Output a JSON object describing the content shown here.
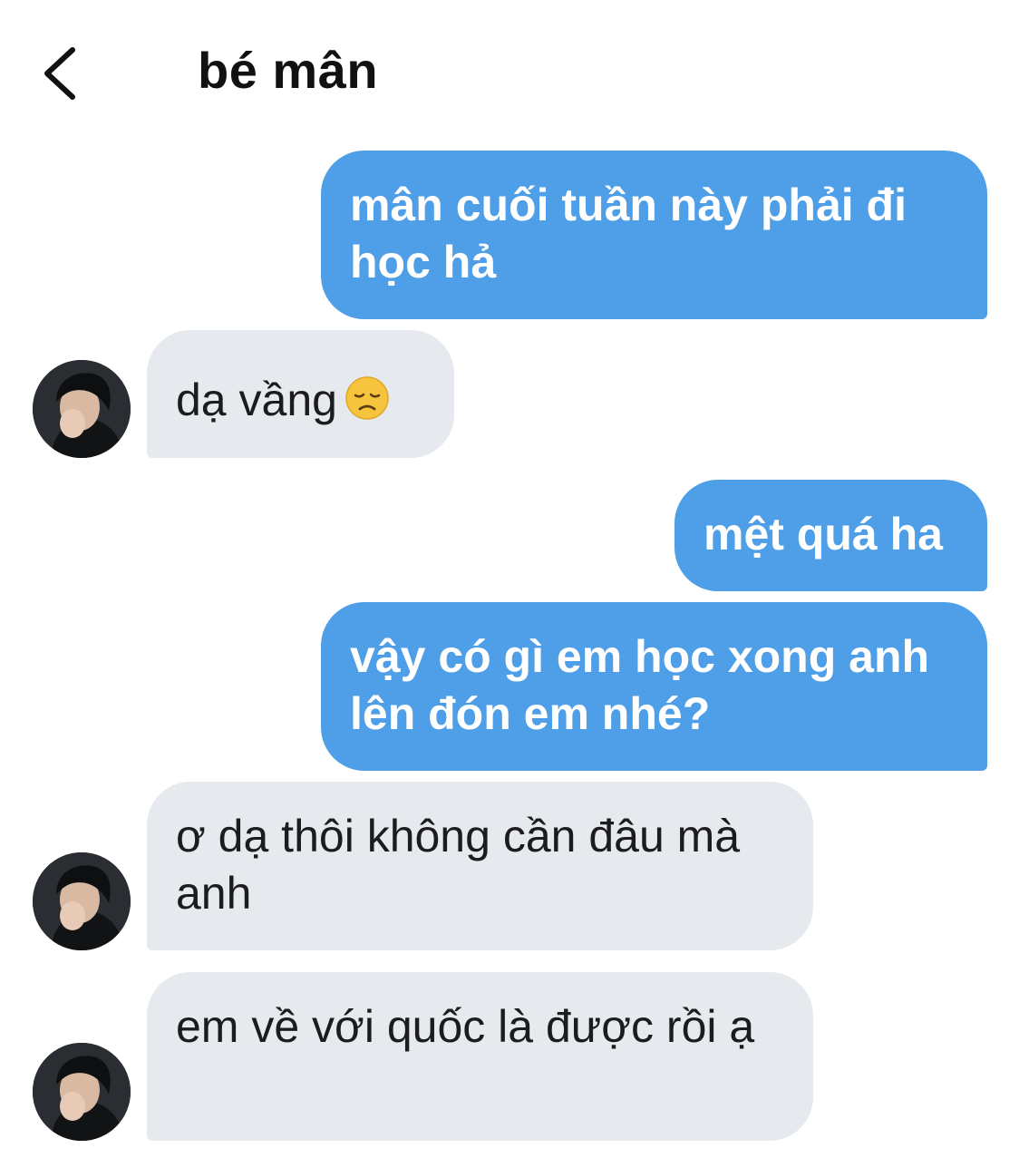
{
  "header": {
    "back_icon": "chevron-left-icon",
    "title": "bé mân"
  },
  "messages": [
    {
      "direction": "outgoing",
      "text": "mân cuối tuần này phải đi học hả"
    },
    {
      "direction": "incoming",
      "text": "dạ vầng",
      "emoji": "disappointed-face"
    },
    {
      "direction": "outgoing",
      "text": "mệt quá ha"
    },
    {
      "direction": "outgoing",
      "text": "vậy có gì em học xong anh lên đón em nhé?"
    },
    {
      "direction": "incoming",
      "text": "ơ dạ thôi không cần đâu mà anh"
    },
    {
      "direction": "incoming",
      "text": "em về với quốc là được rồi ạ"
    }
  ],
  "colors": {
    "outgoing_bubble": "#4e9ee8",
    "incoming_bubble": "#e6eaef",
    "outgoing_text": "#ffffff",
    "incoming_text": "#1c1c1e"
  }
}
